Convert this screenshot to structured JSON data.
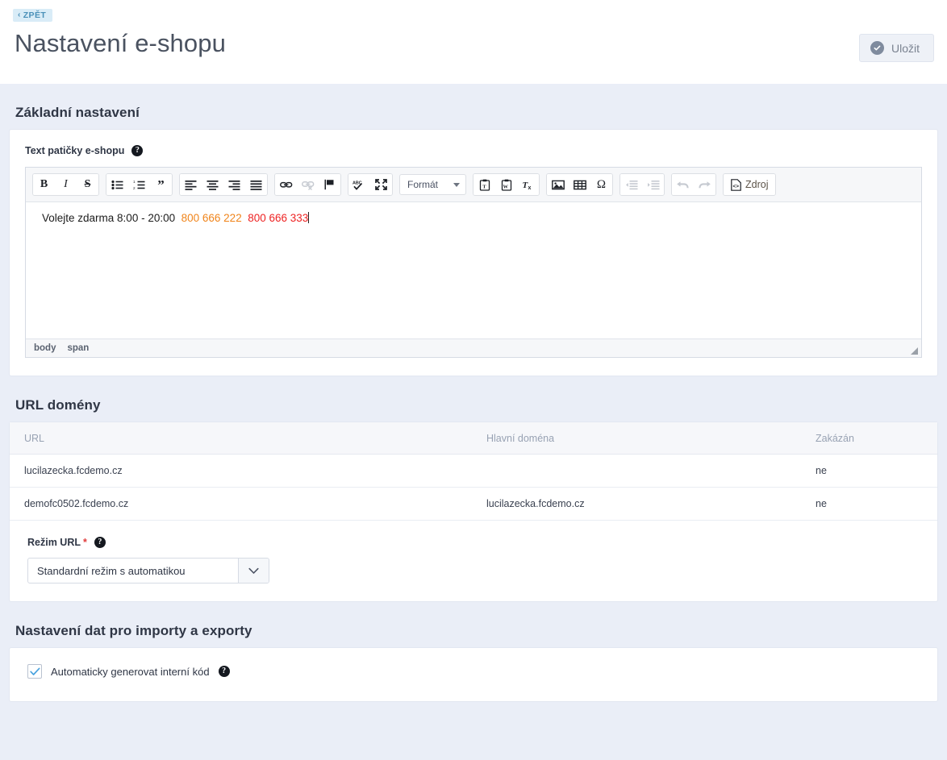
{
  "header": {
    "back_label": "ZPĚT",
    "back_icon": "chevron-left-icon",
    "title": "Nastavení e-shopu",
    "save_label": "Uložit",
    "save_icon": "check-circle-icon"
  },
  "sections": {
    "basic": {
      "title": "Základní nastavení",
      "footer_field": {
        "label": "Text patičky e-shopu",
        "help_icon": "question-mark-icon",
        "editor": {
          "toolbar": {
            "groups": [
              {
                "buttons": [
                  {
                    "name": "bold-button",
                    "label": "B"
                  },
                  {
                    "name": "italic-button",
                    "label": "I"
                  },
                  {
                    "name": "strikethrough-button",
                    "label": "S"
                  }
                ]
              },
              {
                "buttons": [
                  {
                    "name": "bulleted-list-button",
                    "label": ""
                  },
                  {
                    "name": "numbered-list-button",
                    "label": ""
                  },
                  {
                    "name": "blockquote-button",
                    "label": ""
                  }
                ]
              },
              {
                "buttons": [
                  {
                    "name": "align-left-button",
                    "label": ""
                  },
                  {
                    "name": "align-center-button",
                    "label": ""
                  },
                  {
                    "name": "align-right-button",
                    "label": ""
                  },
                  {
                    "name": "align-justify-button",
                    "label": ""
                  }
                ]
              },
              {
                "buttons": [
                  {
                    "name": "link-button",
                    "label": ""
                  },
                  {
                    "name": "unlink-button",
                    "label": "",
                    "disabled": true
                  },
                  {
                    "name": "anchor-button",
                    "label": ""
                  }
                ]
              },
              {
                "buttons": [
                  {
                    "name": "spellcheck-button",
                    "label": ""
                  },
                  {
                    "name": "maximize-button",
                    "label": ""
                  }
                ]
              }
            ],
            "format_select": {
              "label": "Formát",
              "caret_icon": "caret-down-icon"
            },
            "groups2": [
              {
                "buttons": [
                  {
                    "name": "paste-as-text-button",
                    "label": ""
                  },
                  {
                    "name": "paste-from-word-button",
                    "label": ""
                  },
                  {
                    "name": "remove-format-button",
                    "label": ""
                  }
                ]
              },
              {
                "buttons": [
                  {
                    "name": "insert-image-button",
                    "label": ""
                  },
                  {
                    "name": "insert-table-button",
                    "label": ""
                  },
                  {
                    "name": "special-character-button",
                    "label": "Ω"
                  }
                ]
              },
              {
                "buttons": [
                  {
                    "name": "outdent-button",
                    "label": "",
                    "disabled": true
                  },
                  {
                    "name": "indent-button",
                    "label": "",
                    "disabled": true
                  }
                ]
              },
              {
                "buttons": [
                  {
                    "name": "undo-button",
                    "label": "",
                    "disabled": true
                  },
                  {
                    "name": "redo-button",
                    "label": "",
                    "disabled": true
                  }
                ]
              },
              {
                "buttons": [
                  {
                    "name": "source-button",
                    "label": "Zdroj"
                  }
                ]
              }
            ]
          },
          "content": {
            "plain_text": "Volejte zdarma 8:00 - 20:00",
            "phone_orange": "800 666 222",
            "phone_red": "800 666 333",
            "orange_color": "#f0841a",
            "red_color": "#ee2222"
          },
          "status_path": [
            "body",
            "span"
          ]
        }
      }
    },
    "domains": {
      "title": "URL domény",
      "table": {
        "columns": [
          "URL",
          "Hlavní doména",
          "Zakázán"
        ],
        "rows": [
          {
            "url": "lucilazecka.fcdemo.cz",
            "main_domain": "",
            "disabled": "ne"
          },
          {
            "url": "demofc0502.fcdemo.cz",
            "main_domain": "lucilazecka.fcdemo.cz",
            "disabled": "ne"
          }
        ]
      },
      "url_mode": {
        "label": "Režim URL",
        "required_mark": "*",
        "help_icon": "question-mark-icon",
        "value": "Standardní režim s automatikou",
        "arrow_icon": "chevron-down-icon"
      }
    },
    "import_export": {
      "title": "Nastavení dat pro importy a exporty",
      "auto_code": {
        "checked": true,
        "label": "Automaticky generovat interní kód",
        "help_icon": "question-mark-icon",
        "check_color": "#4aa3df"
      }
    }
  }
}
